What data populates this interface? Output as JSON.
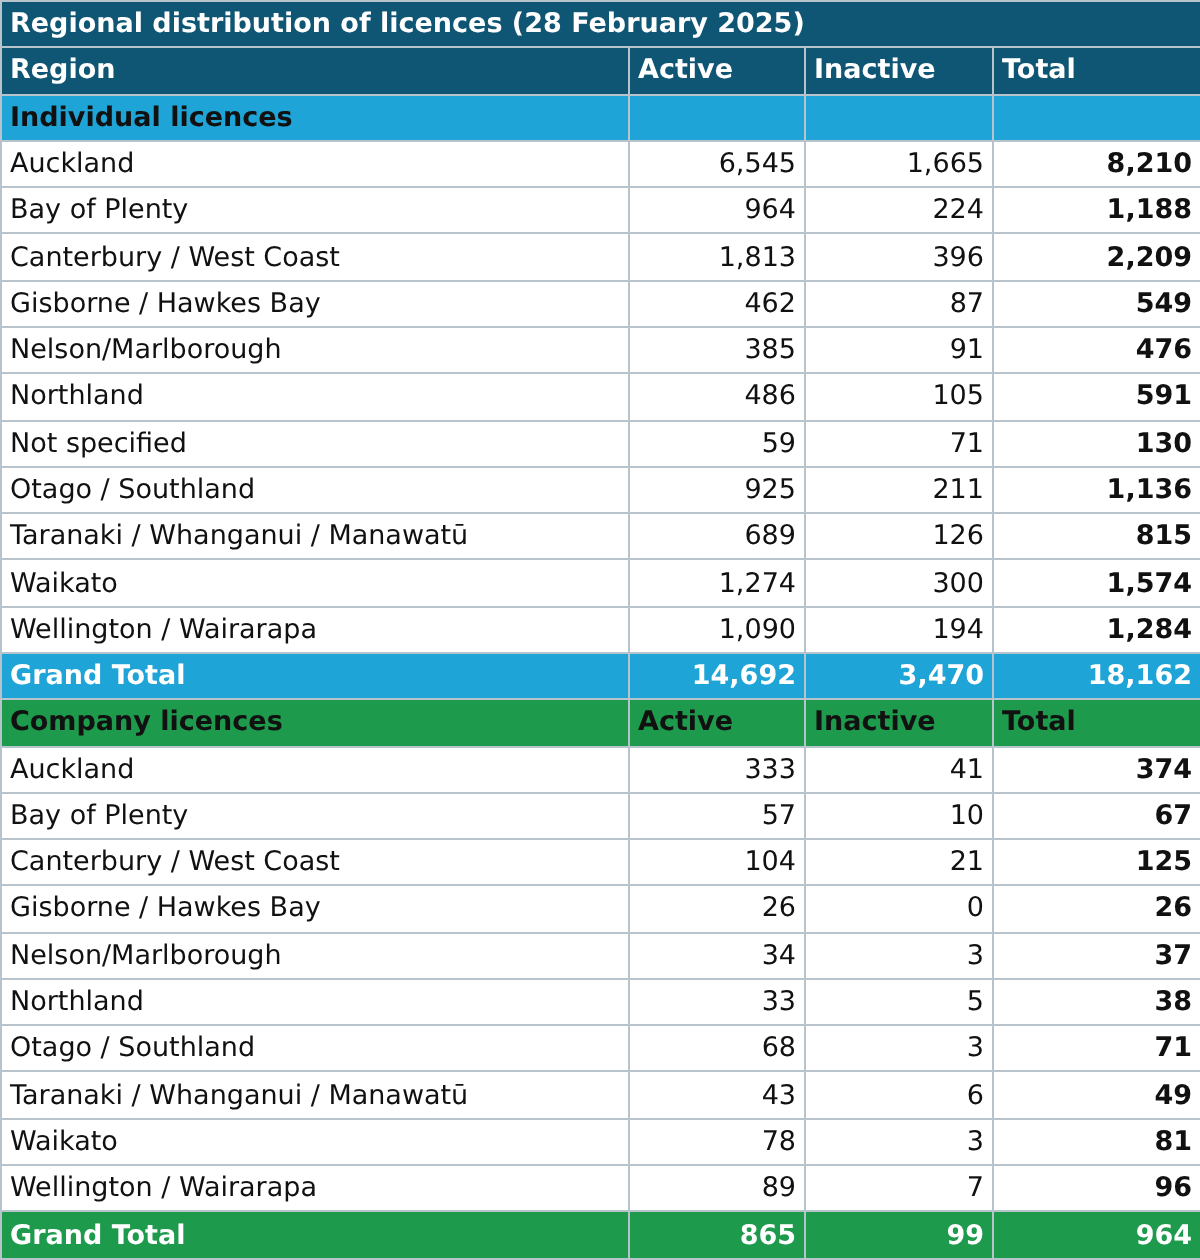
{
  "title": "Regional distribution of licences (28 February 2025)",
  "columns": [
    "Region",
    "Active",
    "Inactive",
    "Total"
  ],
  "sections": [
    {
      "heading": "Individual licences",
      "color": "#1ea4d6",
      "rows": [
        [
          "Auckland",
          "6,545",
          "1,665",
          "8,210"
        ],
        [
          "Bay of Plenty",
          "964",
          "224",
          "1,188"
        ],
        [
          "Canterbury / West Coast",
          "1,813",
          "396",
          "2,209"
        ],
        [
          "Gisborne / Hawkes Bay",
          "462",
          "87",
          "549"
        ],
        [
          "Nelson/Marlborough",
          "385",
          "91",
          "476"
        ],
        [
          "Northland",
          "486",
          "105",
          "591"
        ],
        [
          "Not specified",
          "59",
          "71",
          "130"
        ],
        [
          "Otago / Southland",
          "925",
          "211",
          "1,136"
        ],
        [
          "Taranaki / Whanganui / Manawatū",
          "689",
          "126",
          "815"
        ],
        [
          "Waikato",
          "1,274",
          "300",
          "1,574"
        ],
        [
          "Wellington / Wairarapa",
          "1,090",
          "194",
          "1,284"
        ]
      ],
      "grand_total": [
        "Grand Total",
        "14,692",
        "3,470",
        "18,162"
      ]
    },
    {
      "heading": "Company licences",
      "heading_columns": [
        "Active",
        "Inactive",
        "Total"
      ],
      "color": "#1e9a4c",
      "rows": [
        [
          "Auckland",
          "333",
          "41",
          "374"
        ],
        [
          "Bay of Plenty",
          "57",
          "10",
          "67"
        ],
        [
          "Canterbury / West Coast",
          "104",
          "21",
          "125"
        ],
        [
          "Gisborne / Hawkes Bay",
          "26",
          "0",
          "26"
        ],
        [
          "Nelson/Marlborough",
          "34",
          "3",
          "37"
        ],
        [
          "Northland",
          "33",
          "5",
          "38"
        ],
        [
          "Otago / Southland",
          "68",
          "3",
          "71"
        ],
        [
          "Taranaki / Whanganui / Manawatū",
          "43",
          "6",
          "49"
        ],
        [
          "Waikato",
          "78",
          "3",
          "81"
        ],
        [
          "Wellington / Wairarapa",
          "89",
          "7",
          "96"
        ]
      ],
      "grand_total": [
        "Grand Total",
        "865",
        "99",
        "964"
      ]
    }
  ]
}
